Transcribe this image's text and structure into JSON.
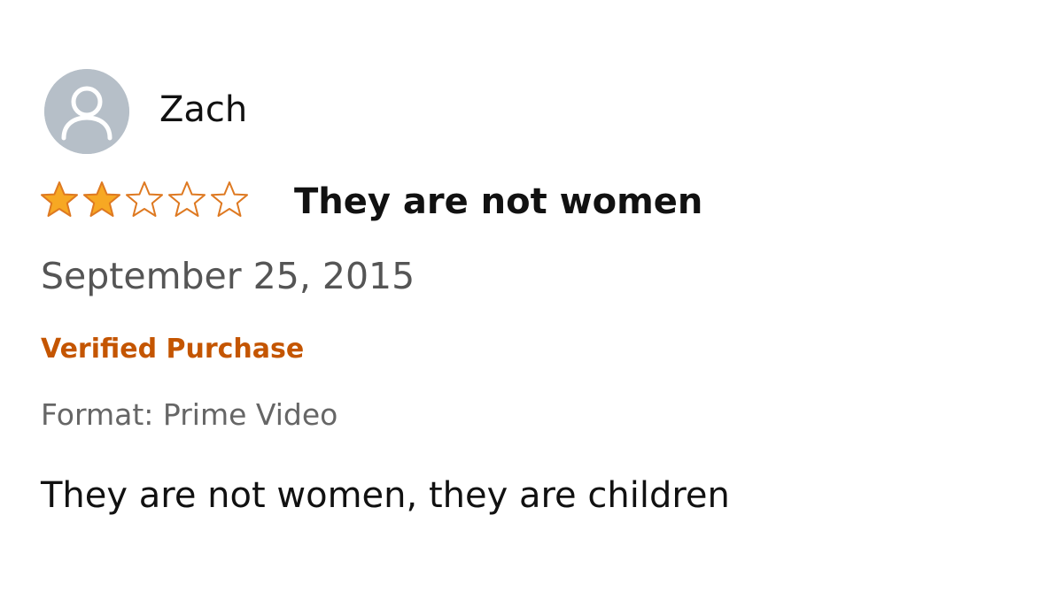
{
  "review": {
    "author_name": "Zach",
    "rating": 2,
    "rating_max": 5,
    "title": "They are not women",
    "date": "September 25, 2015",
    "verified_label": "Verified Purchase",
    "format": "Format: Prime Video",
    "body": "They are not women, they are children"
  },
  "icons": {
    "avatar": "user-avatar-icon",
    "filled_star": "star-filled-icon",
    "empty_star": "star-outline-icon"
  },
  "colors": {
    "star_fill": "#f7a823",
    "star_stroke": "#de7921",
    "verified": "#c45500",
    "avatar_bg": "#b6bfc8",
    "date_text": "#555555"
  }
}
